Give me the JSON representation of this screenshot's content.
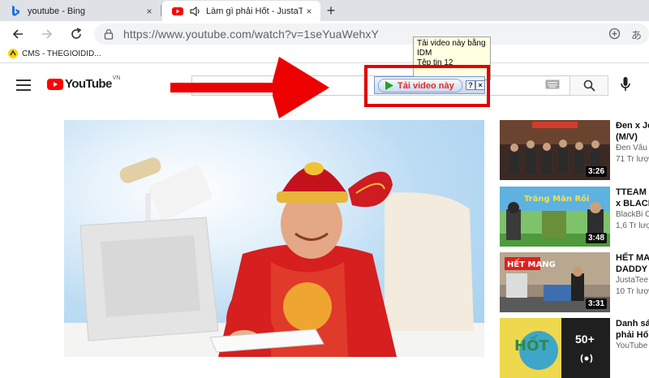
{
  "browser": {
    "tabs": [
      {
        "title": "youtube - Bing",
        "favicon": "bing-icon",
        "close": "×"
      },
      {
        "title": "Làm gì phải Hốt - JustaTee x",
        "favicon": "youtube-favicon",
        "close": "×",
        "audio": "speaker-icon"
      }
    ],
    "new_tab": "+",
    "url": "https://www.youtube.com/watch?v=1seYuaWehxY",
    "extra_icon": "あ",
    "bookmarks": [
      {
        "label": "CMS - THEGIOIDID..."
      }
    ]
  },
  "youtube": {
    "logo_text": "YouTube",
    "logo_region": "VN",
    "search_placeholder": ""
  },
  "idm": {
    "tooltip_line1": "Tải video này bằng",
    "tooltip_line2": "IDM",
    "tooltip_line3": "Tệp tin 12",
    "button_label": "Tải video này",
    "help": "?",
    "close": "×"
  },
  "recommendations": [
    {
      "title": "Đen x Je",
      "title2": "(M/V)",
      "channel": "Đen Vâu",
      "views": "71 Tr lượ",
      "duration": "3:26"
    },
    {
      "title": "TTEAM",
      "title2": "x BLACK",
      "channel": "BlackBi C",
      "views": "1,6 Tr lượ",
      "duration": "3:48"
    },
    {
      "title": "HẾT MA",
      "title2": "DADDY",
      "channel": "JustaTee",
      "views": "10 Tr lượ",
      "duration": "3:31"
    },
    {
      "title": "Danh sá",
      "title2": "phải Hố",
      "channel": "YouTube",
      "views": "",
      "duration": "50+"
    }
  ],
  "colors": {
    "youtube_red": "#ff0000",
    "highlight_red": "#e10000",
    "idm_text": "#e02b2b"
  }
}
